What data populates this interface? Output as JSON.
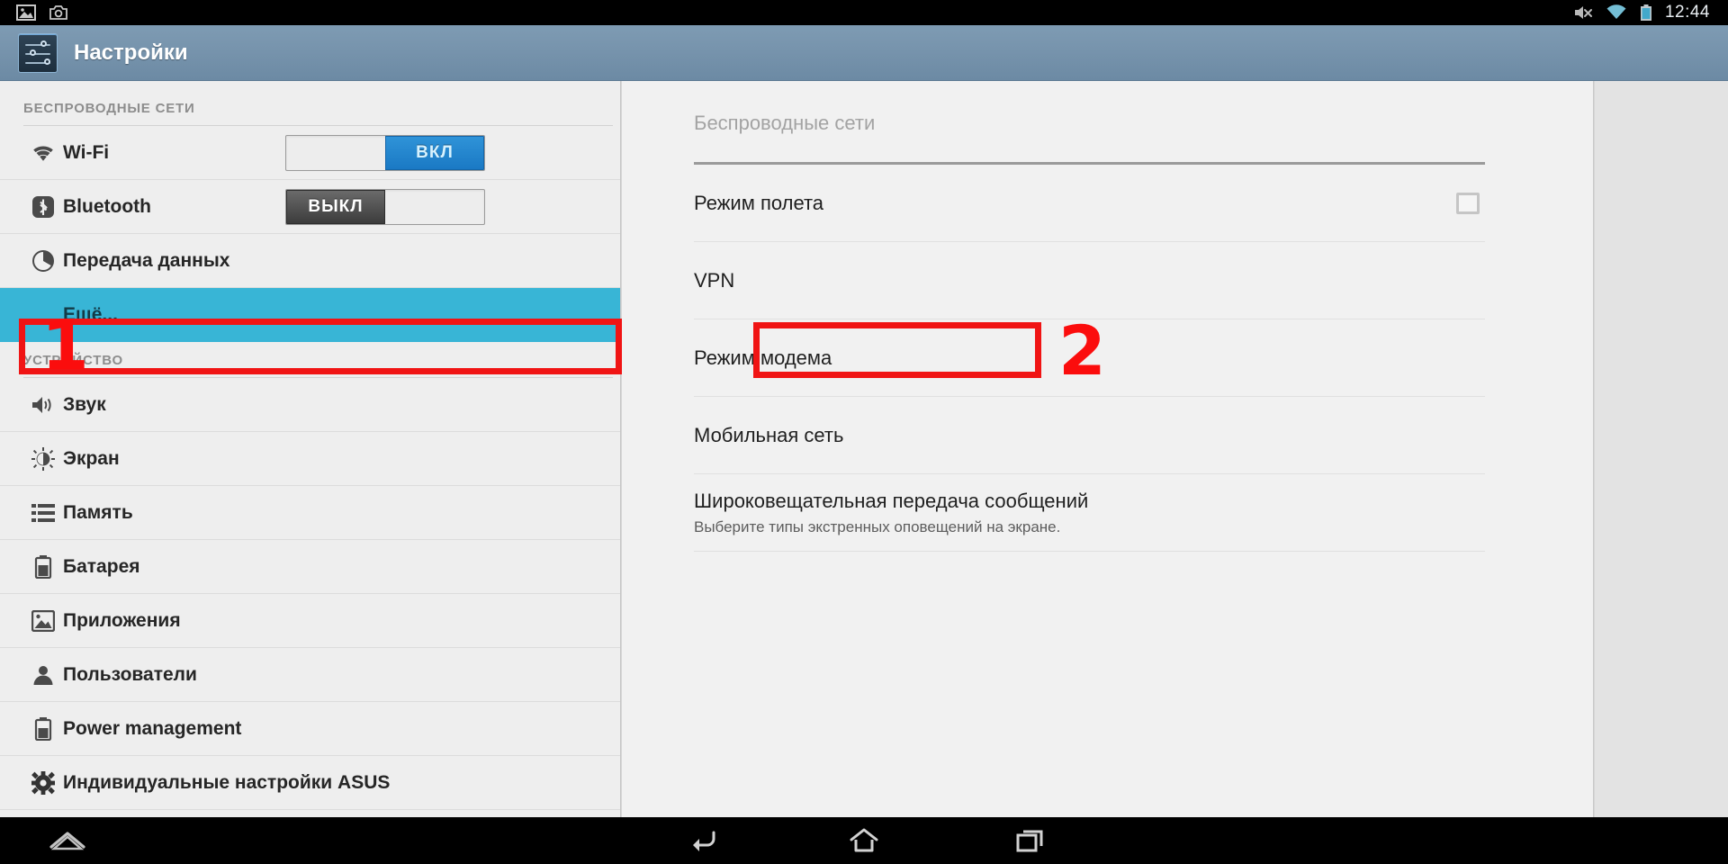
{
  "status_bar": {
    "left_icons": [
      {
        "name": "gallery-icon",
        "label": "Gallery"
      },
      {
        "name": "screenshot-camera-icon",
        "label": "Screenshot"
      }
    ],
    "right_icons": [
      {
        "name": "volume-muted-icon",
        "label": "Muted"
      },
      {
        "name": "wifi-icon",
        "label": "Wi-Fi connected"
      },
      {
        "name": "battery-icon",
        "label": "Battery"
      }
    ],
    "clock": "12:44"
  },
  "title_bar": {
    "app_icon": "settings-sliders-icon",
    "title": "Настройки"
  },
  "sidebar": {
    "sections": [
      {
        "header": "БЕСПРОВОДНЫЕ СЕТИ",
        "items": [
          {
            "icon": "wifi-icon",
            "label": "Wi-Fi",
            "toggle": "ВКЛ",
            "toggle_state": "on"
          },
          {
            "icon": "bluetooth-icon",
            "label": "Bluetooth",
            "toggle": "ВЫКЛ",
            "toggle_state": "off"
          },
          {
            "icon": "data-usage-icon",
            "label": "Передача данных"
          },
          {
            "icon": "none",
            "label": "Ещё...",
            "selected": true
          }
        ]
      },
      {
        "header": "УСТРОЙСТВО",
        "items": [
          {
            "icon": "sound-speaker-icon",
            "label": "Звук"
          },
          {
            "icon": "display-brightness-icon",
            "label": "Экран"
          },
          {
            "icon": "storage-list-icon",
            "label": "Память"
          },
          {
            "icon": "battery-icon",
            "label": "Батарея"
          },
          {
            "icon": "apps-image-icon",
            "label": "Приложения"
          },
          {
            "icon": "user-person-icon",
            "label": "Пользователи"
          },
          {
            "icon": "power-battery-icon",
            "label": "Power management"
          },
          {
            "icon": "gear-icon",
            "label": "Индивидуальные настройки ASUS"
          }
        ]
      }
    ]
  },
  "right_panel": {
    "header": "Беспроводные сети",
    "rows": [
      {
        "title": "Режим полета",
        "control": "checkbox",
        "checked": false
      },
      {
        "title": "VPN"
      },
      {
        "title": "Режим модема",
        "highlighted": true
      },
      {
        "title": "Мобильная сеть"
      },
      {
        "title": "Широковещательная передача сообщений",
        "subtitle": "Выберите типы экстренных оповещений на экране."
      }
    ]
  },
  "annotations": {
    "step_one": "1",
    "step_two": "2",
    "color": "#fb0d0d"
  },
  "nav_bar": {
    "buttons": [
      {
        "name": "nav-expand-icon",
        "label": "Expand"
      },
      {
        "name": "nav-back-icon",
        "label": "Back"
      },
      {
        "name": "nav-home-icon",
        "label": "Home"
      },
      {
        "name": "nav-recents-icon",
        "label": "Recent apps"
      }
    ]
  }
}
